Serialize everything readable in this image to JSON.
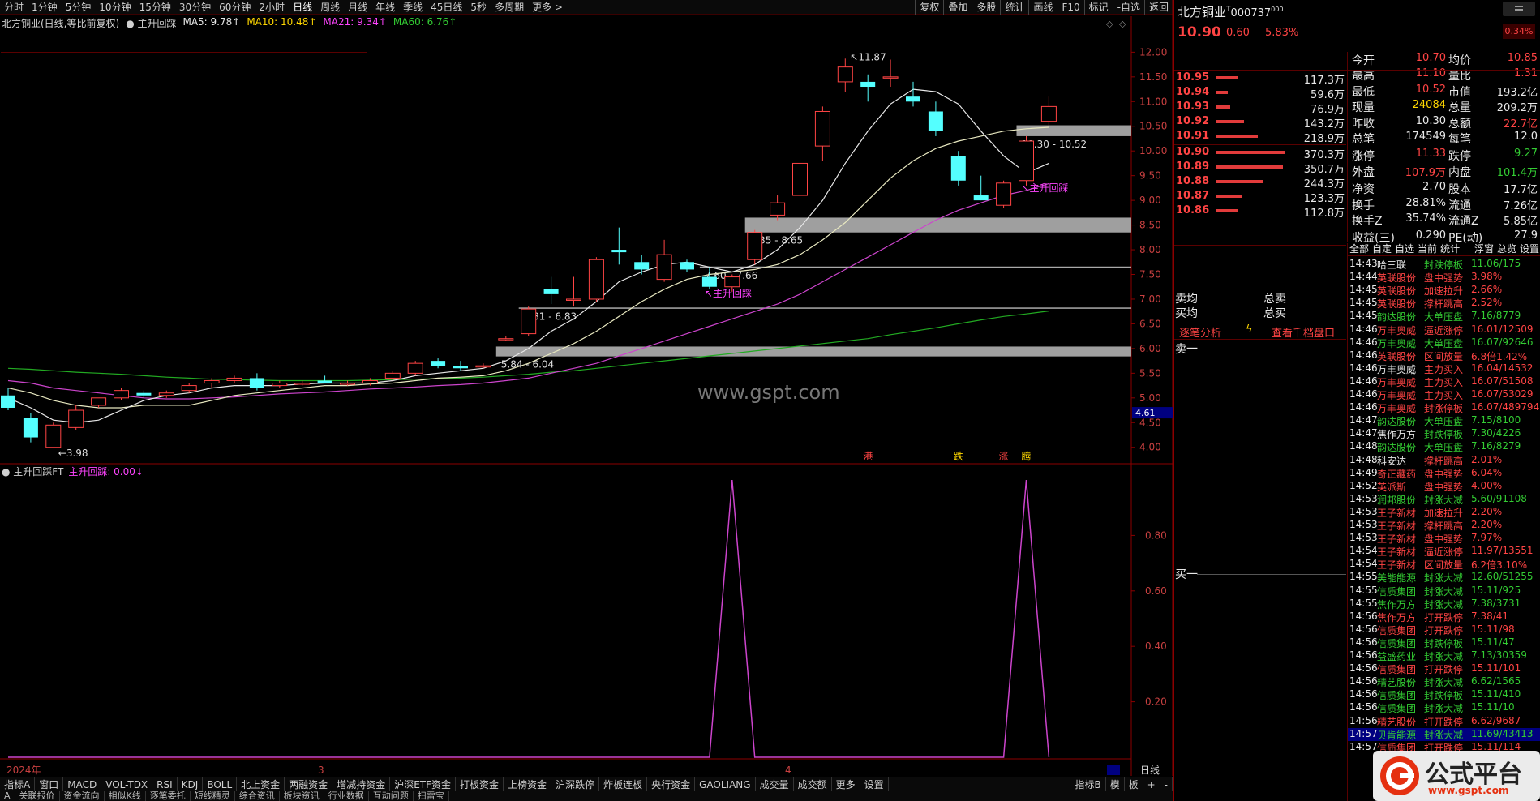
{
  "period_tabs": [
    "分时",
    "1分钟",
    "5分钟",
    "10分钟",
    "15分钟",
    "30分钟",
    "60分钟",
    "2小时",
    "日线",
    "周线",
    "月线",
    "年线",
    "季线",
    "45日线",
    "5秒",
    "多周期",
    "更多 >"
  ],
  "tools": [
    "复权",
    "叠加",
    "多股",
    "统计",
    "画线",
    "F10",
    "标记",
    "-自选",
    "返回"
  ],
  "info": {
    "stock": "北方铜业(日线,等比前复权)",
    "indicator": "● 主升回踩",
    "ma5": "MA5: 9.78↑",
    "ma10": "MA10: 10.48↑",
    "ma21": "MA21: 9.34↑",
    "ma60": "MA60: 6.76↑"
  },
  "sub_info": {
    "name": "● 主升回踩FT",
    "label": "主升回踩: 0.00↓"
  },
  "price_axis": [
    "12.00",
    "11.50",
    "11.00",
    "10.50",
    "10.00",
    "9.50",
    "9.00",
    "8.50",
    "8.00",
    "7.50",
    "7.00",
    "6.50",
    "6.00",
    "5.50",
    "5.00",
    "4.50",
    "4.00"
  ],
  "current_price_tag": "4.61",
  "sub_axis": [
    "0.80",
    "0.60",
    "0.40",
    "0.20"
  ],
  "x_labels": [
    "2024年",
    "3",
    "4"
  ],
  "zone_labels": [
    "10.30 - 10.52",
    "8.35 - 8.65",
    "7.60 - 7.66",
    "6.81 - 6.83",
    "5.84 - 6.04"
  ],
  "hi_label": "11.87",
  "lo_label": "3.98",
  "signal_label": "主升回踩",
  "watermark": "www.gspt.com",
  "markers": [
    "港",
    "跌",
    "涨",
    "腾"
  ],
  "period_label": "日线",
  "bottom_tabs": [
    "指标A",
    "窗口",
    "MACD",
    "VOL-TDX",
    "RSI",
    "KDJ",
    "BOLL",
    "北上资金",
    "两融资金",
    "增减持资金",
    "沪深ETF资金",
    "打板资金",
    "上榜资金",
    "沪深跌停",
    "炸板连板",
    "央行资金",
    "GAOLIANG",
    "成交量",
    "成交额",
    "更多",
    "设置"
  ],
  "bottom_right": [
    "指标B",
    "模",
    "板",
    "+",
    "-"
  ],
  "bottom_tabs2": [
    "A",
    "关联报价",
    "资金流向",
    "相似K线",
    "逐笔委托",
    "短线精灵",
    "综合资讯",
    "板块资讯",
    "行业数据",
    "互动问题",
    "扫雷宝"
  ],
  "quote": {
    "name": "北方铜业",
    "code": "000737",
    "price": "10.90",
    "change": "0.60",
    "pct": "5.83%",
    "badge": "0.34%"
  },
  "orderbook": [
    {
      "p": "10.95",
      "v": "117.3万",
      "w": 0.08
    },
    {
      "p": "10.94",
      "v": "59.6万",
      "w": 0.04
    },
    {
      "p": "10.93",
      "v": "76.9万",
      "w": 0.05
    },
    {
      "p": "10.92",
      "v": "143.2万",
      "w": 0.1
    },
    {
      "p": "10.91",
      "v": "218.9万",
      "w": 0.15
    },
    {
      "p": "10.90",
      "v": "370.3万",
      "w": 0.25
    },
    {
      "p": "10.89",
      "v": "350.7万",
      "w": 0.24
    },
    {
      "p": "10.88",
      "v": "244.3万",
      "w": 0.17
    },
    {
      "p": "10.87",
      "v": "123.3万",
      "w": 0.09
    },
    {
      "p": "10.86",
      "v": "112.8万",
      "w": 0.08
    }
  ],
  "stats_left": [
    [
      "今开",
      "10.70"
    ],
    [
      "最高",
      "11.10"
    ],
    [
      "最低",
      "10.52"
    ],
    [
      "现量",
      "24084"
    ],
    [
      "昨收",
      "10.30"
    ],
    [
      "总笔",
      "174549"
    ],
    [
      "涨停",
      "11.33"
    ],
    [
      "外盘",
      "107.9万"
    ],
    [
      "净资",
      "2.70"
    ],
    [
      "换手",
      "28.81%"
    ],
    [
      "换手Z",
      "35.74%"
    ],
    [
      "收益(三)",
      "0.290"
    ]
  ],
  "stats_right": [
    [
      "均价",
      "10.85"
    ],
    [
      "量比",
      "1.31"
    ],
    [
      "市值",
      "193.2亿"
    ],
    [
      "总量",
      "209.2万"
    ],
    [
      "总额",
      "22.7亿"
    ],
    [
      "每笔",
      "12.0"
    ],
    [
      "跌停",
      "9.27"
    ],
    [
      "内盘",
      "101.4万"
    ],
    [
      "股本",
      "17.7亿"
    ],
    [
      "流通",
      "7.26亿"
    ],
    [
      "流通Z",
      "5.85亿"
    ],
    [
      "PE(动)",
      "27.9"
    ]
  ],
  "mid_labels": {
    "sell_avg": "卖均",
    "buy_avg": "买均",
    "total_sell": "总卖",
    "total_buy": "总买",
    "analysis": "逐笔分析",
    "view": "查看千档盘口",
    "sell1": "卖一",
    "buy1": "买一"
  },
  "list_tabs": [
    "全部",
    "自定",
    "自选",
    "当前",
    "统计",
    "浮窗",
    "总览",
    "设置"
  ],
  "trades": [
    [
      "14:43",
      "哈三联",
      "封跌停板",
      "11.06/175"
    ],
    [
      "14:44",
      "英联股份",
      "盘中强势",
      "3.98%"
    ],
    [
      "14:45",
      "英联股份",
      "加速拉升",
      "2.66%"
    ],
    [
      "14:45",
      "英联股份",
      "撑杆跳高",
      "2.52%"
    ],
    [
      "14:45",
      "韵达股份",
      "大单压盘",
      "7.16/8779"
    ],
    [
      "14:46",
      "万丰奥威",
      "逼近涨停",
      "16.01/12509"
    ],
    [
      "14:46",
      "万丰奥威",
      "大单压盘",
      "16.07/92646"
    ],
    [
      "14:46",
      "英联股份",
      "区间放量",
      "6.8倍1.42%"
    ],
    [
      "14:46",
      "万丰奥威",
      "主力买入",
      "16.04/14532"
    ],
    [
      "14:46",
      "万丰奥威",
      "主力买入",
      "16.07/51508"
    ],
    [
      "14:46",
      "万丰奥威",
      "主力买入",
      "16.07/53029"
    ],
    [
      "14:46",
      "万丰奥威",
      "封涨停板",
      "16.07/489794"
    ],
    [
      "14:47",
      "韵达股份",
      "大单压盘",
      "7.15/8100"
    ],
    [
      "14:47",
      "焦作万方",
      "封跌停板",
      "7.30/4226"
    ],
    [
      "14:48",
      "韵达股份",
      "大单压盘",
      "7.16/8279"
    ],
    [
      "14:48",
      "科安达",
      "撑杆跳高",
      "2.01%"
    ],
    [
      "14:49",
      "奇正藏药",
      "盘中强势",
      "6.04%"
    ],
    [
      "14:52",
      "英派斯",
      "盘中强势",
      "4.00%"
    ],
    [
      "14:53",
      "润邦股份",
      "封涨大减",
      "5.60/91108"
    ],
    [
      "14:53",
      "王子新材",
      "加速拉升",
      "2.20%"
    ],
    [
      "14:53",
      "王子新材",
      "撑杆跳高",
      "2.20%"
    ],
    [
      "14:53",
      "王子新材",
      "盘中强势",
      "7.97%"
    ],
    [
      "14:54",
      "王子新材",
      "逼近涨停",
      "11.97/13551"
    ],
    [
      "14:54",
      "王子新材",
      "区间放量",
      "6.2倍3.10%"
    ],
    [
      "14:55",
      "美能能源",
      "封涨大减",
      "12.60/51255"
    ],
    [
      "14:55",
      "信质集团",
      "封涨大减",
      "15.11/925"
    ],
    [
      "14:55",
      "焦作万方",
      "封涨大减",
      "7.38/3731"
    ],
    [
      "14:56",
      "焦作万方",
      "打开跌停",
      "7.38/41"
    ],
    [
      "14:56",
      "信质集团",
      "打开跌停",
      "15.11/98"
    ],
    [
      "14:56",
      "信质集团",
      "封跌停板",
      "15.11/47"
    ],
    [
      "14:56",
      "益盛药业",
      "封涨大减",
      "7.13/30359"
    ],
    [
      "14:56",
      "信质集团",
      "打开跌停",
      "15.11/101"
    ],
    [
      "14:56",
      "精艺股份",
      "封涨大减",
      "6.62/1565"
    ],
    [
      "14:56",
      "信质集团",
      "封跌停板",
      "15.11/410"
    ],
    [
      "14:56",
      "信质集团",
      "封涨大减",
      "15.11/10"
    ],
    [
      "14:56",
      "精艺股份",
      "打开跌停",
      "6.62/9687"
    ],
    [
      "14:57",
      "贝肯能源",
      "封涨大减",
      "11.69/43413"
    ],
    [
      "14:57",
      "信质集团",
      "打开跌停",
      "15.11/114"
    ]
  ],
  "logo": {
    "text": "公式平台",
    "url": "www.gspt.com"
  },
  "chart_data": {
    "type": "candlestick",
    "title": "",
    "ylim": [
      3.7,
      12.4
    ],
    "candles": [
      {
        "o": 5.05,
        "h": 5.2,
        "l": 4.75,
        "c": 4.8
      },
      {
        "o": 4.6,
        "h": 4.7,
        "l": 4.1,
        "c": 4.2
      },
      {
        "o": 4.0,
        "h": 4.5,
        "l": 3.98,
        "c": 4.45
      },
      {
        "o": 4.4,
        "h": 4.85,
        "l": 4.35,
        "c": 4.75
      },
      {
        "o": 4.85,
        "h": 5.0,
        "l": 4.8,
        "c": 5.0
      },
      {
        "o": 5.0,
        "h": 5.2,
        "l": 4.95,
        "c": 5.15
      },
      {
        "o": 5.1,
        "h": 5.15,
        "l": 5.0,
        "c": 5.05
      },
      {
        "o": 5.05,
        "h": 5.15,
        "l": 5.0,
        "c": 5.1
      },
      {
        "o": 5.15,
        "h": 5.3,
        "l": 5.1,
        "c": 5.25
      },
      {
        "o": 5.3,
        "h": 5.4,
        "l": 5.2,
        "c": 5.35
      },
      {
        "o": 5.35,
        "h": 5.45,
        "l": 5.3,
        "c": 5.4
      },
      {
        "o": 5.4,
        "h": 5.5,
        "l": 5.15,
        "c": 5.2
      },
      {
        "o": 5.25,
        "h": 5.35,
        "l": 5.2,
        "c": 5.3
      },
      {
        "o": 5.3,
        "h": 5.35,
        "l": 5.25,
        "c": 5.3
      },
      {
        "o": 5.35,
        "h": 5.45,
        "l": 5.3,
        "c": 5.3
      },
      {
        "o": 5.3,
        "h": 5.35,
        "l": 5.25,
        "c": 5.3
      },
      {
        "o": 5.3,
        "h": 5.4,
        "l": 5.25,
        "c": 5.35
      },
      {
        "o": 5.4,
        "h": 5.55,
        "l": 5.35,
        "c": 5.5
      },
      {
        "o": 5.5,
        "h": 5.75,
        "l": 5.45,
        "c": 5.7
      },
      {
        "o": 5.75,
        "h": 5.8,
        "l": 5.6,
        "c": 5.65
      },
      {
        "o": 5.65,
        "h": 5.75,
        "l": 5.55,
        "c": 5.6
      },
      {
        "o": 5.65,
        "h": 5.7,
        "l": 5.6,
        "c": 5.65
      },
      {
        "o": 6.2,
        "h": 6.25,
        "l": 6.15,
        "c": 6.2
      },
      {
        "o": 6.3,
        "h": 6.85,
        "l": 6.25,
        "c": 6.8
      },
      {
        "o": 7.2,
        "h": 7.45,
        "l": 6.9,
        "c": 7.1
      },
      {
        "o": 7.0,
        "h": 7.45,
        "l": 6.85,
        "c": 7.0
      },
      {
        "o": 7.0,
        "h": 7.85,
        "l": 6.95,
        "c": 7.8
      },
      {
        "o": 8.0,
        "h": 8.45,
        "l": 7.7,
        "c": 7.95
      },
      {
        "o": 7.75,
        "h": 7.9,
        "l": 7.5,
        "c": 7.6
      },
      {
        "o": 7.4,
        "h": 8.2,
        "l": 7.35,
        "c": 7.9
      },
      {
        "o": 7.75,
        "h": 7.8,
        "l": 7.55,
        "c": 7.6
      },
      {
        "o": 7.45,
        "h": 7.65,
        "l": 7.2,
        "c": 7.25
      },
      {
        "o": 7.25,
        "h": 7.5,
        "l": 7.15,
        "c": 7.45
      },
      {
        "o": 7.8,
        "h": 8.4,
        "l": 7.7,
        "c": 8.35
      },
      {
        "o": 8.7,
        "h": 9.1,
        "l": 8.6,
        "c": 8.95
      },
      {
        "o": 9.1,
        "h": 9.9,
        "l": 9.05,
        "c": 9.75
      },
      {
        "o": 10.1,
        "h": 10.9,
        "l": 9.8,
        "c": 10.8
      },
      {
        "o": 11.4,
        "h": 11.87,
        "l": 11.2,
        "c": 11.7
      },
      {
        "o": 11.4,
        "h": 11.55,
        "l": 11.0,
        "c": 11.3
      },
      {
        "o": 11.5,
        "h": 11.85,
        "l": 11.3,
        "c": 11.5
      },
      {
        "o": 11.1,
        "h": 11.4,
        "l": 10.9,
        "c": 11.0
      },
      {
        "o": 10.8,
        "h": 11.0,
        "l": 10.3,
        "c": 10.4
      },
      {
        "o": 9.9,
        "h": 10.0,
        "l": 9.3,
        "c": 9.4
      },
      {
        "o": 9.1,
        "h": 9.5,
        "l": 9.0,
        "c": 9.0
      },
      {
        "o": 8.9,
        "h": 9.4,
        "l": 8.85,
        "c": 9.35
      },
      {
        "o": 9.4,
        "h": 10.3,
        "l": 9.3,
        "c": 10.2
      },
      {
        "o": 10.6,
        "h": 11.1,
        "l": 10.52,
        "c": 10.9
      }
    ],
    "ma5": [
      5.0,
      4.8,
      4.55,
      4.5,
      4.55,
      4.75,
      4.95,
      5.05,
      5.1,
      5.2,
      5.25,
      5.25,
      5.25,
      5.28,
      5.3,
      5.3,
      5.3,
      5.35,
      5.45,
      5.5,
      5.55,
      5.6,
      5.75,
      6.0,
      6.35,
      6.6,
      6.95,
      7.35,
      7.55,
      7.7,
      7.75,
      7.65,
      7.55,
      7.7,
      8.0,
      8.45,
      9.0,
      9.75,
      10.4,
      10.95,
      11.25,
      11.2,
      10.95,
      10.4,
      9.9,
      9.55,
      9.75
    ],
    "ma10": [
      5.2,
      5.1,
      4.95,
      4.85,
      4.8,
      4.8,
      4.85,
      4.85,
      4.85,
      4.95,
      5.05,
      5.1,
      5.15,
      5.2,
      5.25,
      5.25,
      5.28,
      5.3,
      5.35,
      5.4,
      5.42,
      5.45,
      5.55,
      5.7,
      5.9,
      6.1,
      6.35,
      6.65,
      6.95,
      7.2,
      7.4,
      7.5,
      7.55,
      7.6,
      7.7,
      7.9,
      8.2,
      8.55,
      9.0,
      9.45,
      9.8,
      10.05,
      10.2,
      10.3,
      10.4,
      10.45,
      10.48
    ],
    "ma21": [
      5.35,
      5.3,
      5.2,
      5.15,
      5.1,
      5.05,
      5.0,
      4.98,
      4.98,
      5.0,
      5.02,
      5.05,
      5.08,
      5.1,
      5.12,
      5.15,
      5.18,
      5.2,
      5.22,
      5.25,
      5.27,
      5.3,
      5.35,
      5.4,
      5.5,
      5.6,
      5.7,
      5.85,
      6.0,
      6.15,
      6.3,
      6.45,
      6.6,
      6.75,
      6.9,
      7.1,
      7.35,
      7.6,
      7.85,
      8.1,
      8.35,
      8.6,
      8.8,
      8.95,
      9.1,
      9.2,
      9.34
    ],
    "ma60": [
      5.6,
      5.58,
      5.55,
      5.52,
      5.5,
      5.48,
      5.45,
      5.42,
      5.4,
      5.38,
      5.37,
      5.36,
      5.35,
      5.35,
      5.35,
      5.35,
      5.36,
      5.37,
      5.38,
      5.39,
      5.4,
      5.42,
      5.45,
      5.48,
      5.52,
      5.55,
      5.6,
      5.65,
      5.7,
      5.75,
      5.8,
      5.85,
      5.9,
      5.95,
      6.0,
      6.05,
      6.1,
      6.15,
      6.2,
      6.28,
      6.35,
      6.42,
      6.5,
      6.58,
      6.65,
      6.7,
      6.76
    ],
    "zones": [
      {
        "lo": 10.3,
        "hi": 10.52,
        "start": 45
      },
      {
        "lo": 8.35,
        "hi": 8.65,
        "start": 33
      },
      {
        "lo": 7.6,
        "hi": 7.66,
        "start": 31
      },
      {
        "lo": 6.81,
        "hi": 6.83,
        "start": 23
      },
      {
        "lo": 5.84,
        "hi": 6.04,
        "start": 22
      }
    ],
    "signal": [
      0,
      0,
      0,
      0,
      0,
      0,
      0,
      0,
      0,
      0,
      0,
      0,
      0,
      0,
      0,
      0,
      0,
      0,
      0,
      0,
      0,
      0,
      0,
      0,
      0,
      0,
      0,
      0,
      0,
      0,
      0,
      0,
      1,
      0,
      0,
      0,
      0,
      0,
      0,
      0,
      0,
      0,
      0,
      0,
      0,
      1,
      0
    ]
  }
}
